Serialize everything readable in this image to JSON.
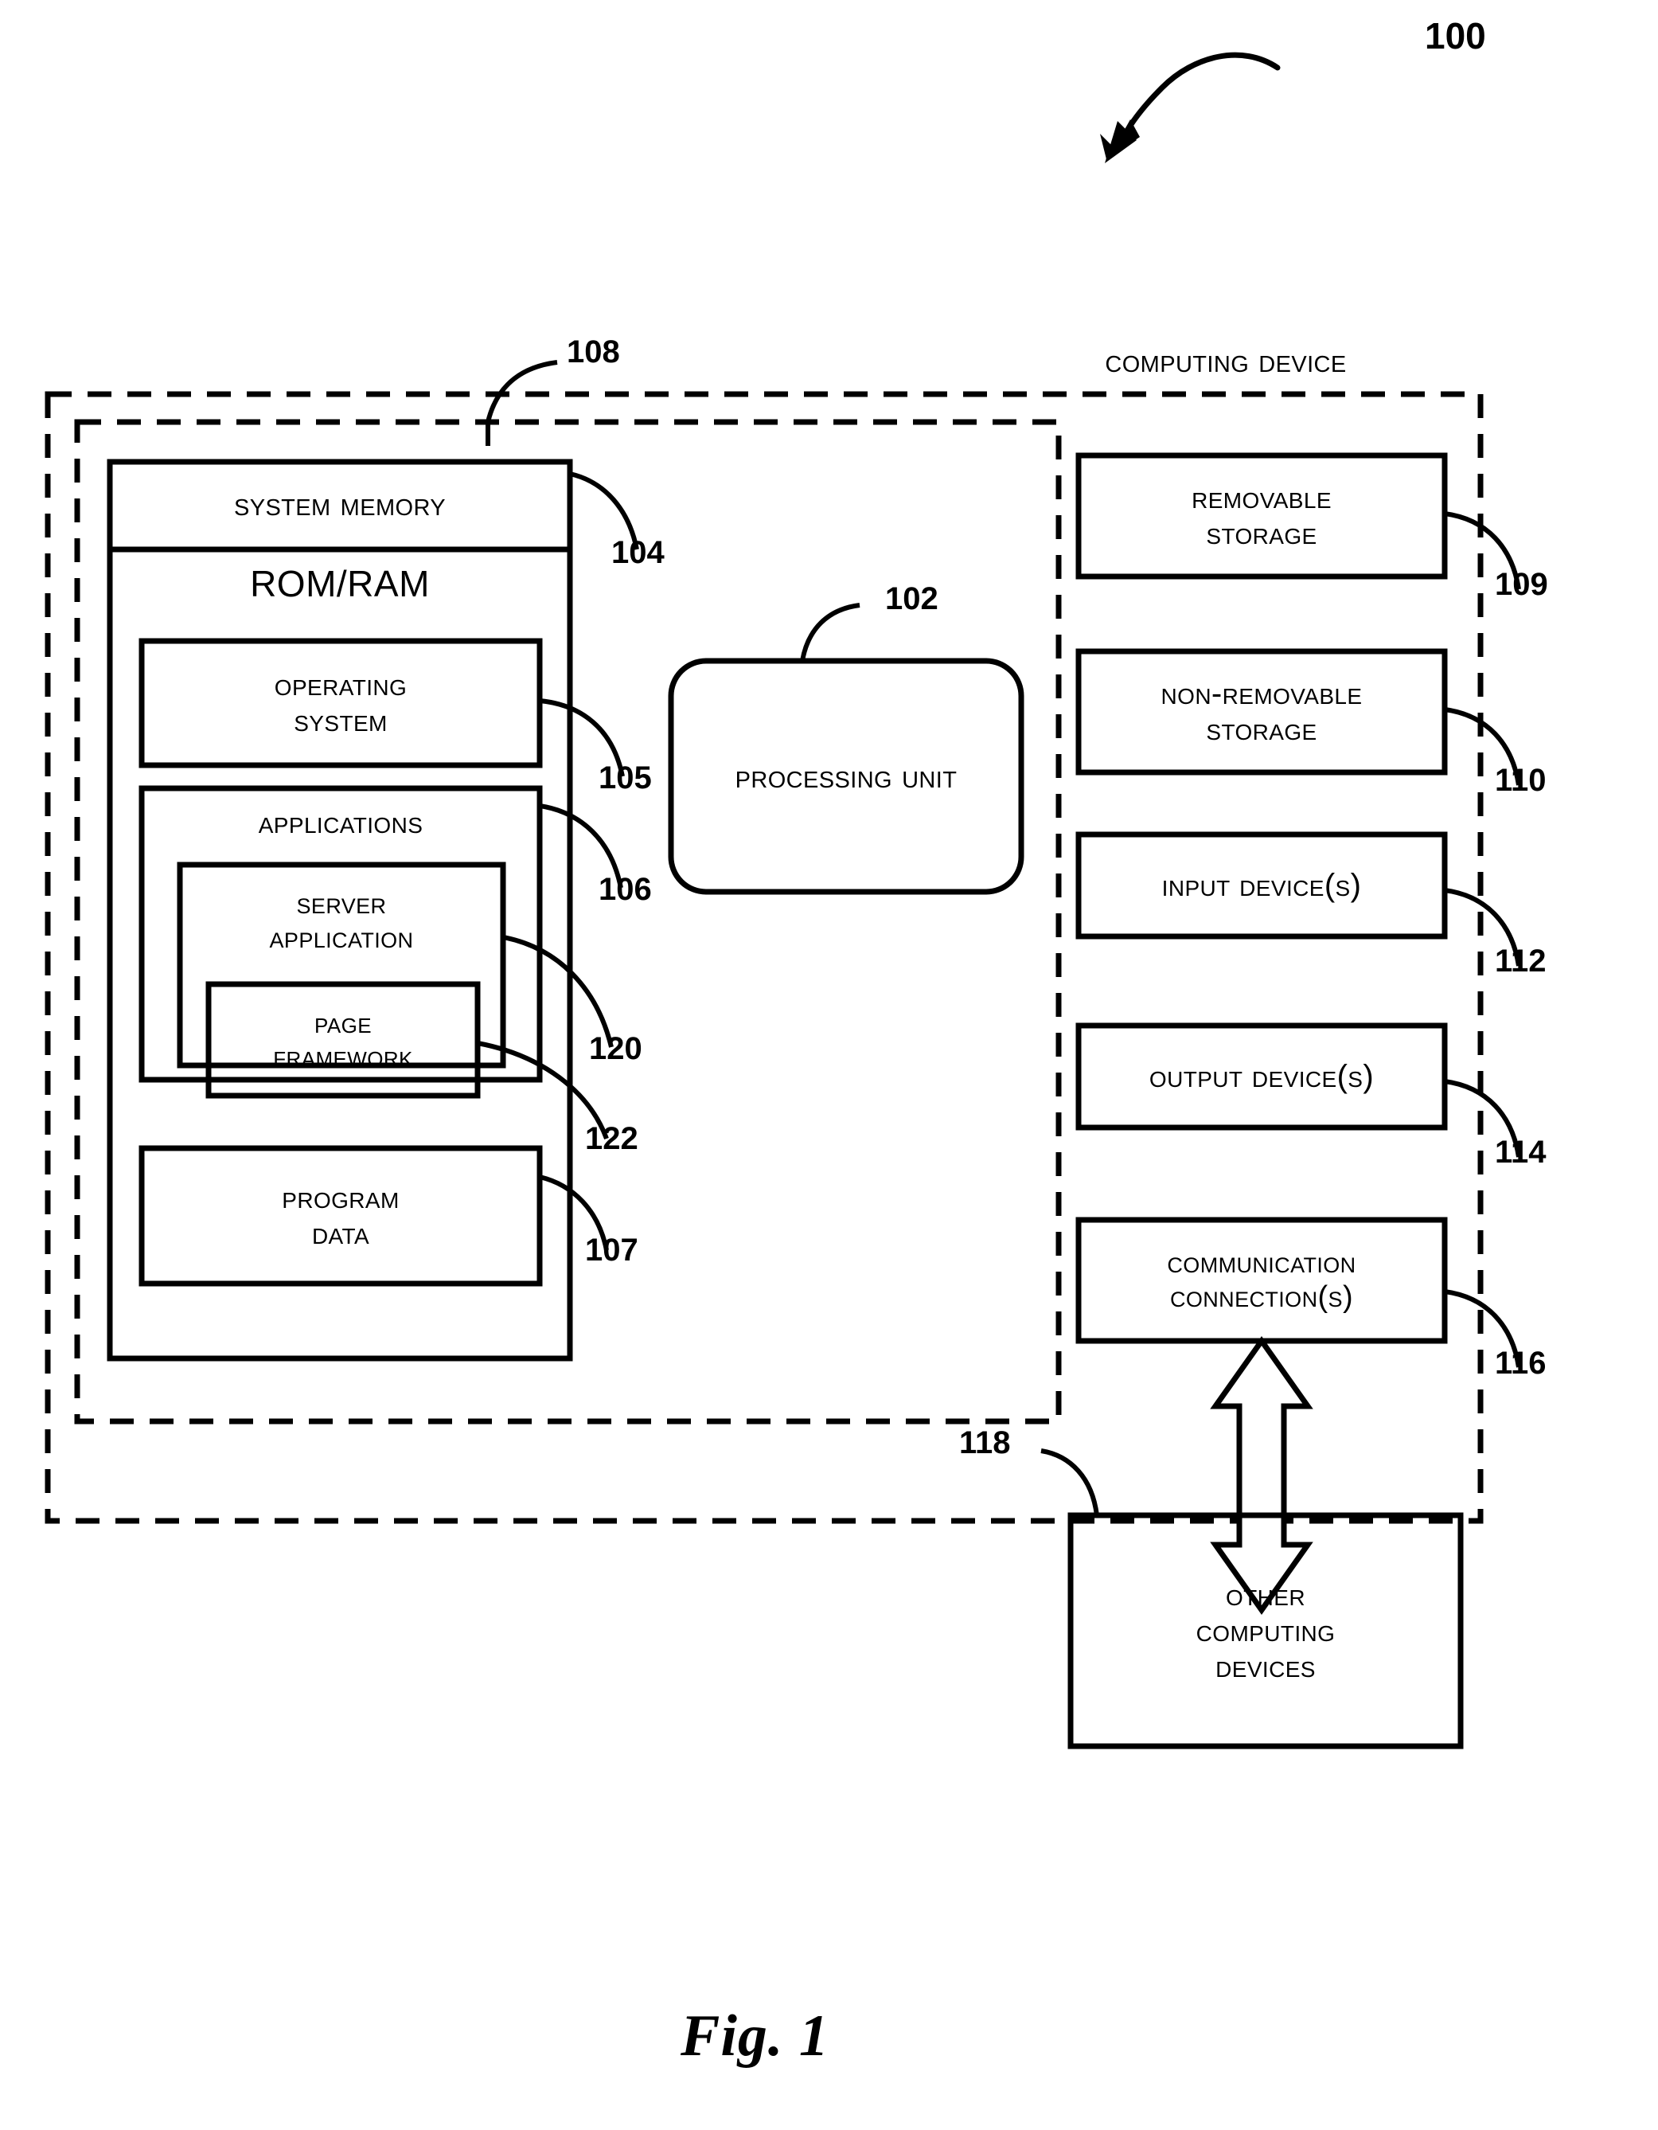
{
  "figure": {
    "caption": "Fig. 1",
    "system_ref": "100"
  },
  "computing_device": {
    "title": "Computing Device",
    "outer_boundary_ref": "",
    "inner_boundary_ref": "108"
  },
  "system_memory": {
    "title": "System Memory",
    "ref": "104",
    "memory_type": "ROM/RAM",
    "operating_system": {
      "label_line1": "Operating",
      "label_line2": "System",
      "ref": "105"
    },
    "applications": {
      "label": "Applications",
      "ref": "106",
      "server_application": {
        "label_line1": "Server",
        "label_line2": "Application",
        "ref": "120",
        "page_framework": {
          "label_line1": "Page",
          "label_line2": "Framework",
          "ref": "122"
        }
      }
    },
    "program_data": {
      "label_line1": "Program",
      "label_line2": "Data",
      "ref": "107"
    }
  },
  "processing_unit": {
    "label": "Processing Unit",
    "ref": "102"
  },
  "peripherals": [
    {
      "label_line1": "Removable",
      "label_line2": "Storage",
      "ref": "109"
    },
    {
      "label_line1": "Non-Removable",
      "label_line2": "Storage",
      "ref": "110"
    },
    {
      "label_line1": "Input Device(s)",
      "label_line2": "",
      "ref": "112"
    },
    {
      "label_line1": "Output Device(s)",
      "label_line2": "",
      "ref": "114"
    },
    {
      "label_line1": "Communication",
      "label_line2": "Connection(s)",
      "ref": "116"
    }
  ],
  "other_devices": {
    "label_line1": "Other",
    "label_line2": "Computing",
    "label_line3": "Devices",
    "ref": "118"
  },
  "colors": {
    "ink": "#000000",
    "paper": "#ffffff"
  }
}
